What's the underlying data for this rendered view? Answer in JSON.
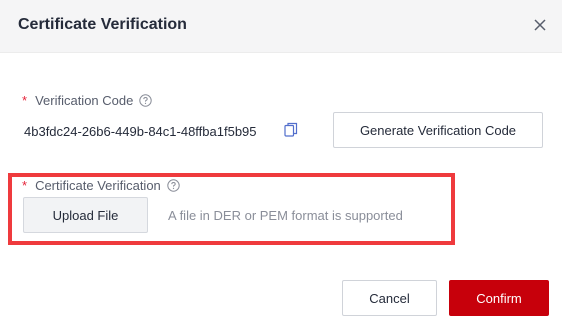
{
  "dialog": {
    "title": "Certificate Verification",
    "close_icon": "close-icon"
  },
  "verification_code": {
    "required_mark": "*",
    "label": "Verification Code",
    "help_icon": "question-circle-icon",
    "value": "4b3fdc24-26b6-449b-84c1-48ffba1f5b95",
    "copy_icon": "copy-icon",
    "generate_button_label": "Generate Verification Code"
  },
  "certificate": {
    "required_mark": "*",
    "label": "Certificate Verification",
    "help_icon": "question-circle-icon",
    "upload_button_label": "Upload File",
    "hint": "A file in DER or PEM format is supported"
  },
  "footer": {
    "cancel_label": "Cancel",
    "confirm_label": "Confirm"
  },
  "colors": {
    "accent": "#c7000b",
    "required": "#e6243a",
    "link_icon": "#526ecc",
    "highlight": "#ef3a3d"
  }
}
